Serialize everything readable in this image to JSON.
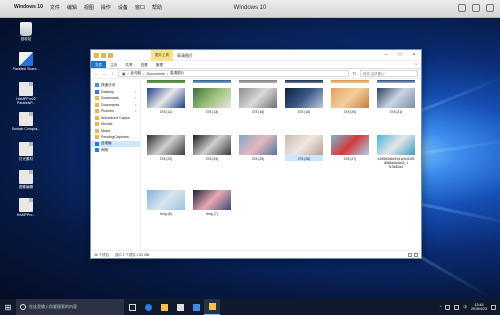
{
  "host": {
    "apple": "",
    "app_name": "Windows 10",
    "menu": [
      "文件",
      "编辑",
      "视图",
      "操作",
      "设备",
      "窗口",
      "帮助"
    ],
    "window_title": "Windows 10"
  },
  "desktop_icons": [
    {
      "label": "回收站",
      "icon": "recycle-bin-icon"
    },
    {
      "label": "Parallels Share...",
      "icon": "parallels-share-icon"
    },
    {
      "label": "HAMPPro22 ParallelsP...",
      "icon": "document-icon"
    },
    {
      "label": "Smicab Compos...",
      "icon": "document-icon"
    },
    {
      "label": "灯光素材",
      "icon": "document-icon"
    },
    {
      "label": "图像编辑",
      "icon": "document-icon"
    },
    {
      "label": "HAMPPro...",
      "icon": "document-icon"
    }
  ],
  "explorer": {
    "context_tab": "图片工具",
    "title": "高清图片",
    "ribbon_tabs": [
      "文件",
      "主页",
      "共享",
      "查看",
      "管理"
    ],
    "address": [
      "此电脑",
      "Documents",
      "高清图片"
    ],
    "search_placeholder": "搜索\"高清图片\"",
    "nav_items": [
      {
        "label": "快速访问",
        "icon": "star-icon",
        "pinned": false
      },
      {
        "label": "Desktop",
        "icon": "folder-icon",
        "pinned": true
      },
      {
        "label": "Downloads",
        "icon": "folder-icon",
        "pinned": true
      },
      {
        "label": "Documents",
        "icon": "folder-icon",
        "pinned": true
      },
      {
        "label": "Pictures",
        "icon": "folder-icon",
        "pinned": true
      },
      {
        "label": "Autosaved Captur",
        "icon": "folder-icon",
        "pinned": false
      },
      {
        "label": "Movies",
        "icon": "folder-icon",
        "pinned": false
      },
      {
        "label": "Music",
        "icon": "folder-icon",
        "pinned": false
      },
      {
        "label": "PendingCaptures",
        "icon": "folder-icon",
        "pinned": false
      },
      {
        "label": "此电脑",
        "icon": "computer-icon",
        "pinned": false,
        "selected": true
      },
      {
        "label": "网络",
        "icon": "network-icon",
        "pinned": false
      }
    ],
    "top_strip": [
      {
        "label": "",
        "colors": [
          "#4b7a3b",
          "#6a9c4c"
        ]
      },
      {
        "label": "",
        "colors": [
          "#2e5a8a",
          "#7ba5c9"
        ]
      },
      {
        "label": "",
        "colors": [
          "#7a7a7a",
          "#b5b5b5"
        ]
      },
      {
        "label": "",
        "colors": [
          "#1b2c4b",
          "#6b7b97"
        ]
      },
      {
        "label": "",
        "colors": [
          "#d89a4c",
          "#edc590"
        ]
      },
      {
        "label": "",
        "colors": [
          "#2b4a7a",
          "#9ab0d0"
        ]
      }
    ],
    "row1": [
      {
        "label": "378 (11)",
        "colors": [
          "#1d3d8a",
          "#e8e8e8",
          "#1d3d8a"
        ]
      },
      {
        "label": "378 (13)",
        "colors": [
          "#3c6f3e",
          "#9cc07a",
          "#e6e8e0"
        ]
      },
      {
        "label": "378 (16)",
        "colors": [
          "#8a8a8a",
          "#d9d9d9",
          "#6e6e6e"
        ]
      },
      {
        "label": "378 (18)",
        "colors": [
          "#0f1e3a",
          "#3a5a8a",
          "#c0c8d8"
        ]
      },
      {
        "label": "378 (20)",
        "colors": [
          "#e3a25a",
          "#f2cfa0",
          "#c77b3a"
        ]
      },
      {
        "label": "378 (21)",
        "colors": [
          "#2d3d57",
          "#c9d4e4",
          "#7f8ea6"
        ]
      }
    ],
    "row2": [
      {
        "label": "378 (22)",
        "colors": [
          "#2c2c2c",
          "#d0d0d0",
          "#3a3a3a"
        ]
      },
      {
        "label": "378 (24)",
        "colors": [
          "#1a1a1a",
          "#cfcfcf",
          "#3a3a3a"
        ]
      },
      {
        "label": "378 (25)",
        "colors": [
          "#7fa7c4",
          "#e9b7c0",
          "#4c7a9a"
        ]
      },
      {
        "label": "378 (26)",
        "colors": [
          "#c9b8b0",
          "#f1e7e2",
          "#b99e95"
        ],
        "selected": true
      },
      {
        "label": "378 (27)",
        "colors": [
          "#7ab8d8",
          "#d43a3a",
          "#a5d5ec"
        ]
      },
      {
        "label": "e2e8d3d8e1941e5412f5 d0a8a4a4a43_1 f13640a3",
        "colors": [
          "#47b5d8",
          "#e6e6e6",
          "#3a9cc4"
        ]
      }
    ],
    "row3": [
      {
        "label": "timg (6)",
        "colors": [
          "#7fb0d8",
          "#d8e6ef",
          "#9cc2de"
        ]
      },
      {
        "label": "timg (7)",
        "colors": [
          "#16203e",
          "#e9a9b0",
          "#3a4a7a"
        ]
      }
    ],
    "status": {
      "count": "36 个项目",
      "selection": "选中 1 个项目 2.83 MB"
    }
  },
  "taskbar": {
    "search_placeholder": "在这里输入你要搜索的内容",
    "apps": [
      "task-view-icon",
      "edge-icon",
      "file-explorer-icon",
      "store-icon",
      "mail-icon",
      "explorer-window-icon"
    ],
    "tray_ime": "中",
    "time": "13:45",
    "date": "2019/4/23"
  }
}
